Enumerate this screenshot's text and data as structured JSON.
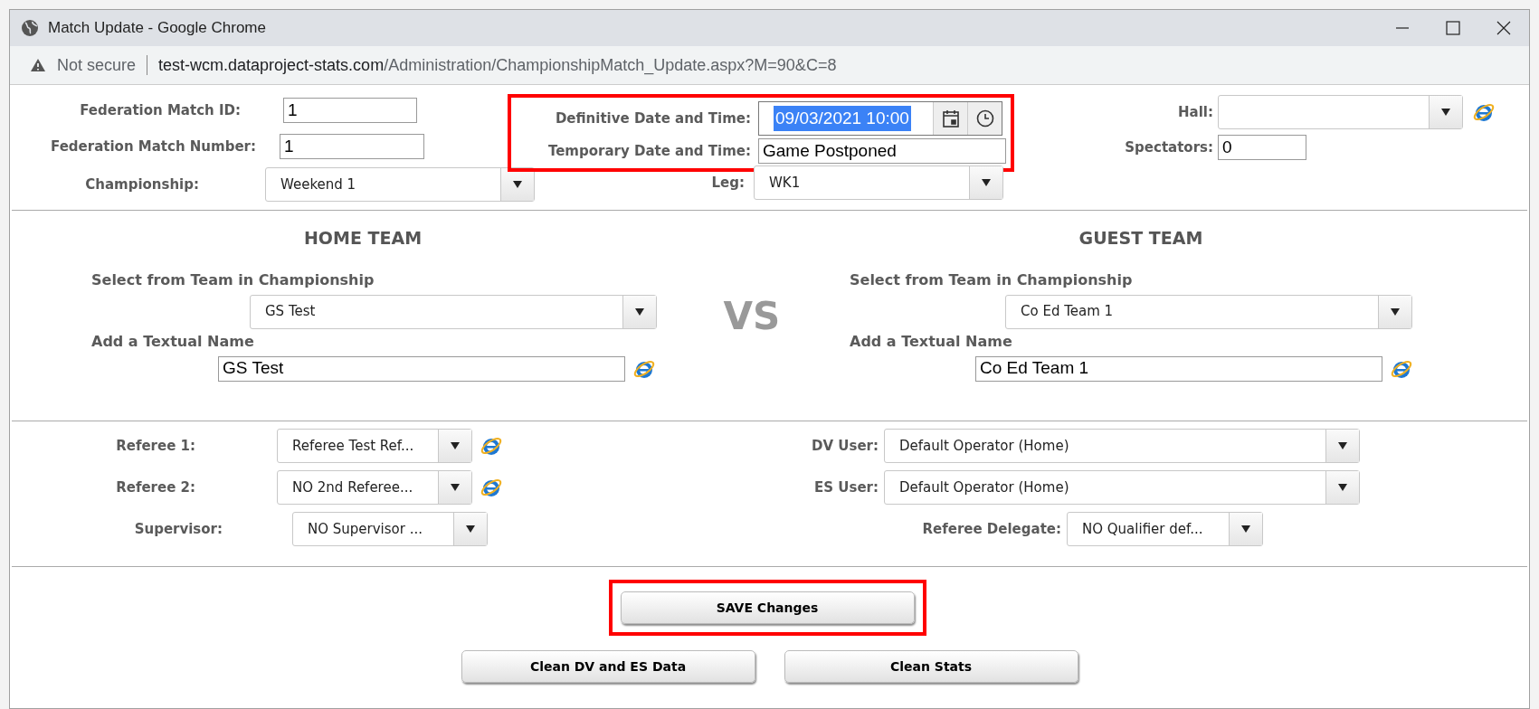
{
  "window": {
    "title": "Match Update - Google Chrome"
  },
  "address_bar": {
    "security": "Not secure",
    "host": "test-wcm.dataproject-stats.com",
    "path": "/Administration/ChampionshipMatch_Update.aspx?M=90&C=8"
  },
  "left_fields": [
    {
      "kind": "text",
      "label": "Federation Match ID:",
      "value": "1"
    },
    {
      "kind": "text",
      "label": "Federation Match Number:",
      "value": "1"
    },
    {
      "kind": "select",
      "label": "Championship:",
      "value": "Weekend 1"
    }
  ],
  "date_group": {
    "highlighted": true,
    "fields": [
      {
        "kind": "datetime",
        "label": "Definitive Date and Time:",
        "value": "09/03/2021 10:00",
        "selected": true
      },
      {
        "kind": "text",
        "label": "Temporary Date and Time:",
        "value": "Game Postponed"
      }
    ]
  },
  "leg": {
    "kind": "select",
    "label": "Leg:",
    "value": "WK1"
  },
  "right_fields": [
    {
      "kind": "select",
      "label": "Hall:",
      "link_icon": true
    },
    {
      "kind": "text",
      "label": "Spectators:",
      "value": "0"
    }
  ],
  "home_team": {
    "heading": "HOME TEAM",
    "select_label": "Select from Team in Championship",
    "team": "GS Test",
    "name_label": "Add a Textual Name",
    "name": "GS Test"
  },
  "versus": "VS",
  "guest_team": {
    "heading": "GUEST TEAM",
    "select_label": "Select from Team in Championship",
    "team": "Co Ed Team 1",
    "name_label": "Add a Textual Name",
    "name": "Co Ed Team 1"
  },
  "officials_left": [
    {
      "label": "Referee 1:",
      "value": "Referee Test Ref...",
      "link_icon": true
    },
    {
      "label": "Referee 2:",
      "value": "NO 2nd Referee...",
      "link_icon": true
    },
    {
      "label": "Supervisor:",
      "value": "NO Supervisor ...",
      "link_icon": false
    }
  ],
  "officials_right": [
    {
      "label": "DV User:",
      "value": "Default Operator (Home)"
    },
    {
      "label": "ES User:",
      "value": "Default Operator (Home)"
    },
    {
      "label": "Referee Delegate:",
      "value": "NO Qualifier def..."
    }
  ],
  "save_button": {
    "label": "SAVE Changes",
    "highlighted": true
  },
  "secondary_buttons": [
    "Clean DV and ES Data",
    "Clean Stats"
  ]
}
